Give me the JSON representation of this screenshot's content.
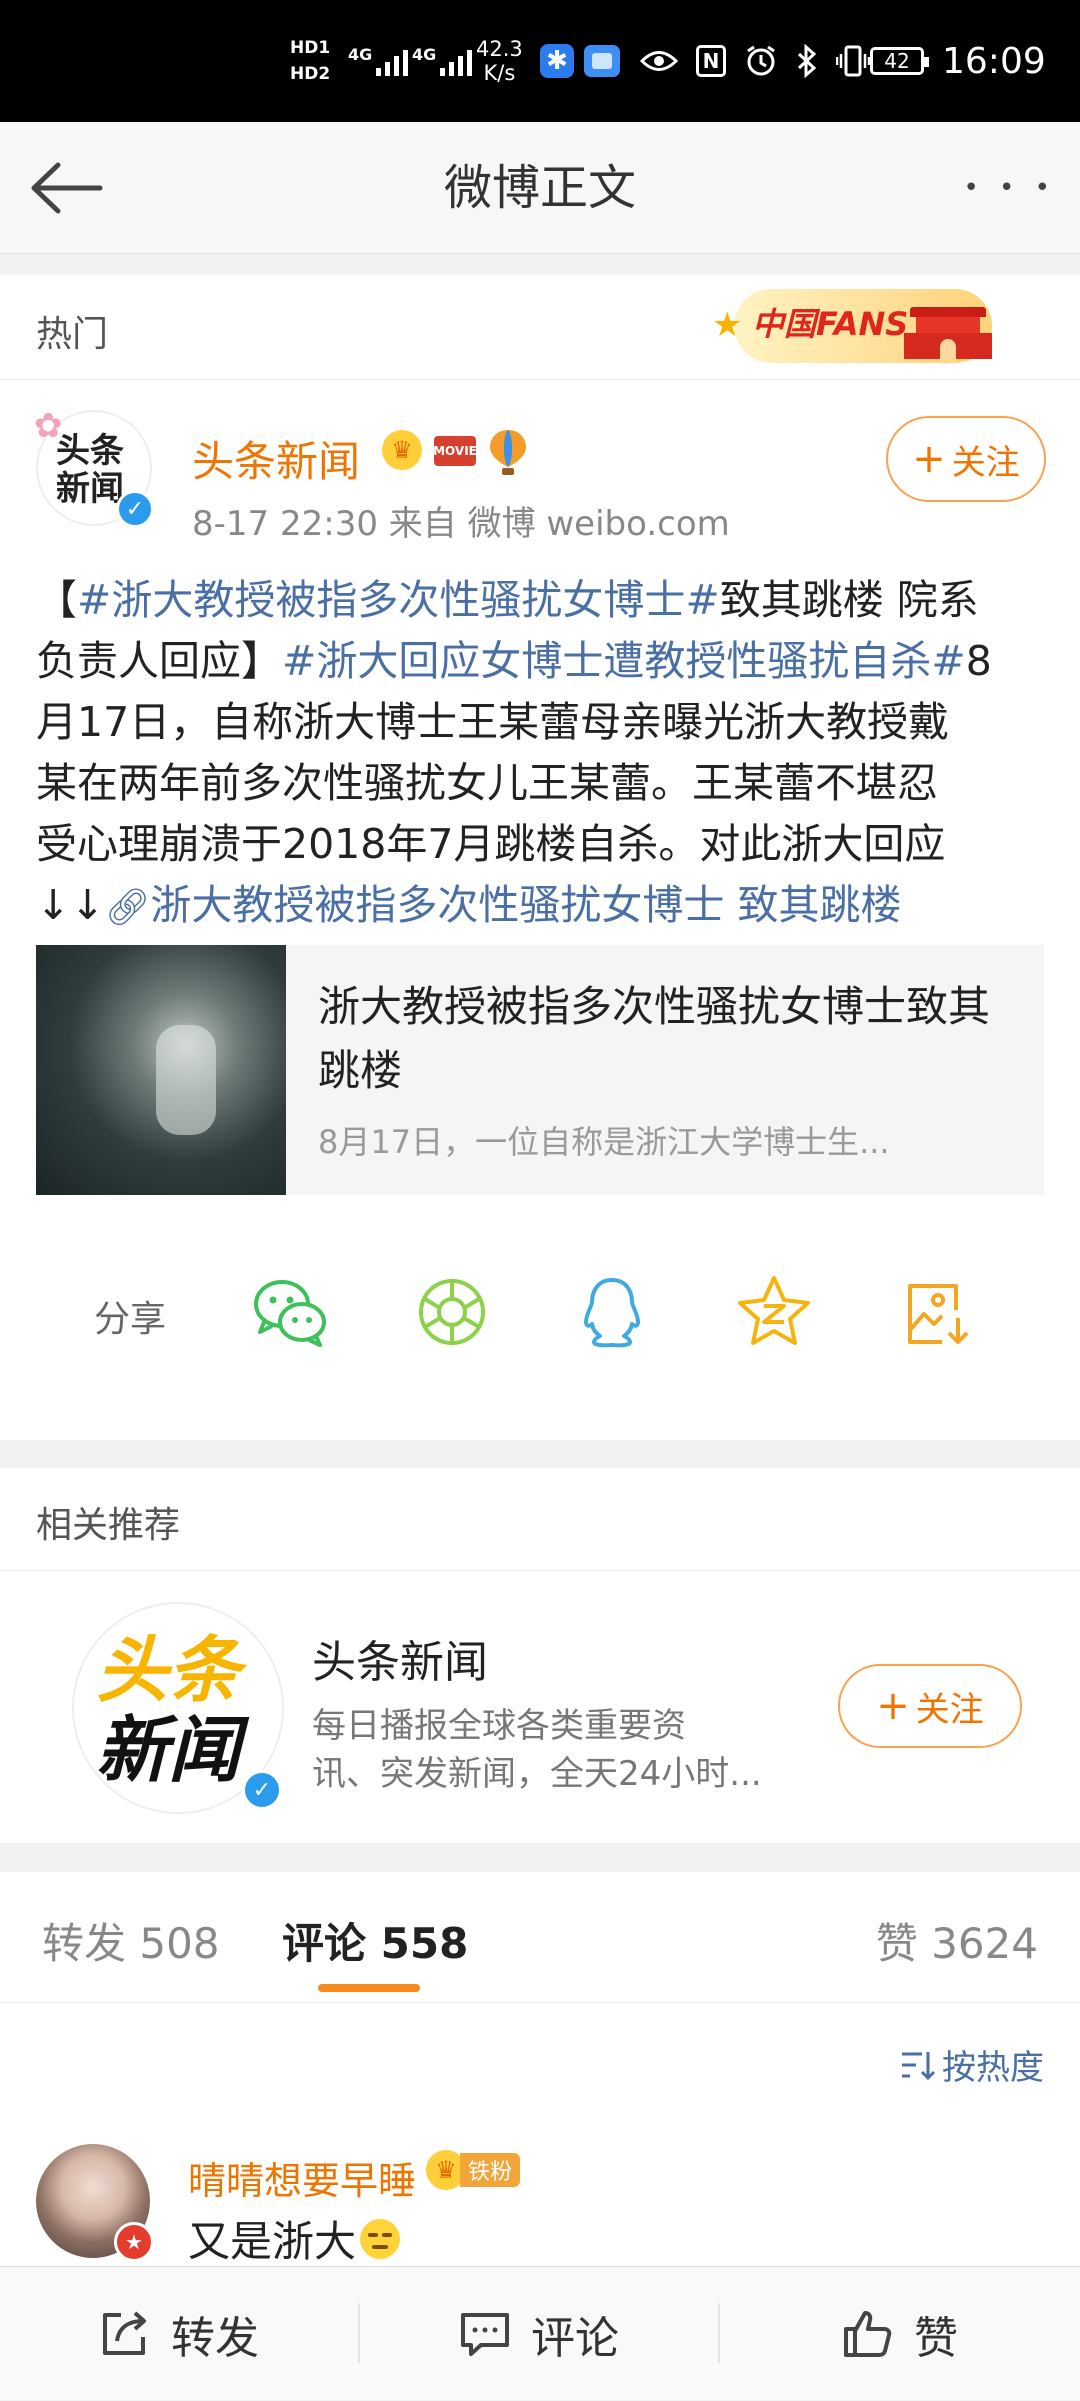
{
  "status_bar": {
    "hd1": "HD1",
    "hd2": "HD2",
    "net1": "4G",
    "net2": "4G",
    "speed_value": "42.3",
    "speed_unit": "K/s",
    "nfc": "N",
    "battery": "42",
    "time": "16:09"
  },
  "nav": {
    "title": "微博正文",
    "more": "• • •"
  },
  "hot": {
    "label": "热门",
    "banner_text": "中国FANS"
  },
  "post": {
    "logo_line1": "头条",
    "logo_line2": "新闻",
    "author": "头条新闻",
    "badge_movie": "MOVIE",
    "time_source": "8-17 22:30   来自 微博 weibo.com",
    "follow_label": "关注",
    "text": {
      "l1_a": "【",
      "l1_topic": "#浙大教授被指多次性骚扰女博士#",
      "l1_b": "致其跳楼 院系",
      "l2_a": "负责人回应】",
      "l2_topic": "#浙大回应女博士遭教授性骚扰自杀#",
      "l2_b": "8",
      "l3": "月17日，自称浙大博士王某蕾母亲曝光浙大教授戴",
      "l4": "某在两年前多次性骚扰女儿王某蕾。王某蕾不堪忍",
      "l5": "受心理崩溃于2018年7月跳楼自杀。对此浙大回应",
      "l6_arrows": "↓↓",
      "l6_link": "浙大教授被指多次性骚扰女博士 致其跳楼"
    },
    "card": {
      "title": "浙大教授被指多次性骚扰女博士致其跳楼",
      "desc": "8月17日，一位自称是浙江大学博士生..."
    }
  },
  "share": {
    "label": "分享"
  },
  "related": {
    "label": "相关推荐",
    "logo_line1": "头条",
    "logo_line2": "新闻",
    "name": "头条新闻",
    "desc_line1": "每日播报全球各类重要资",
    "desc_line2": "讯、突发新闻，全天24小时...",
    "follow_label": "关注"
  },
  "tabs": {
    "repost": "转发 508",
    "comment": "评论 558",
    "like": "赞 3624"
  },
  "sort": {
    "label": "按热度"
  },
  "comment": {
    "user": "晴晴想要早睡",
    "fan_badge": "铁粉",
    "text": "又是浙大"
  },
  "bottom": {
    "repost": "转发",
    "comment": "评论",
    "like": "赞"
  }
}
